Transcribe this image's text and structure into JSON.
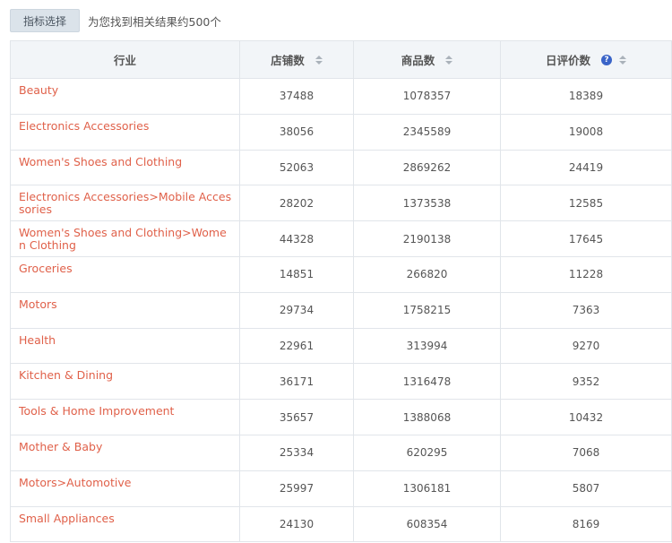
{
  "toolbar": {
    "filter_button": "指标选择",
    "result_text": "为您找到相关结果约500个"
  },
  "table": {
    "headers": {
      "industry": "行业",
      "stores": "店铺数",
      "products": "商品数",
      "daily_reviews": "日评价数"
    },
    "help_icon_glyph": "?",
    "rows": [
      {
        "industry": "Beauty",
        "stores": "37488",
        "products": "1078357",
        "daily_reviews": "18389"
      },
      {
        "industry": "Electronics Accessories",
        "stores": "38056",
        "products": "2345589",
        "daily_reviews": "19008"
      },
      {
        "industry": "Women's Shoes and Clothing",
        "stores": "52063",
        "products": "2869262",
        "daily_reviews": "24419"
      },
      {
        "industry": "Electronics Accessories>Mobile Accessories",
        "stores": "28202",
        "products": "1373538",
        "daily_reviews": "12585"
      },
      {
        "industry": "Women's Shoes and Clothing>Women Clothing",
        "stores": "44328",
        "products": "2190138",
        "daily_reviews": "17645"
      },
      {
        "industry": "Groceries",
        "stores": "14851",
        "products": "266820",
        "daily_reviews": "11228"
      },
      {
        "industry": "Motors",
        "stores": "29734",
        "products": "1758215",
        "daily_reviews": "7363"
      },
      {
        "industry": "Health",
        "stores": "22961",
        "products": "313994",
        "daily_reviews": "9270"
      },
      {
        "industry": "Kitchen & Dining",
        "stores": "36171",
        "products": "1316478",
        "daily_reviews": "9352"
      },
      {
        "industry": "Tools & Home Improvement",
        "stores": "35657",
        "products": "1388068",
        "daily_reviews": "10432"
      },
      {
        "industry": "Mother & Baby",
        "stores": "25334",
        "products": "620295",
        "daily_reviews": "7068"
      },
      {
        "industry": "Motors>Automotive",
        "stores": "25997",
        "products": "1306181",
        "daily_reviews": "5807"
      },
      {
        "industry": "Small Appliances",
        "stores": "24130",
        "products": "608354",
        "daily_reviews": "8169"
      }
    ]
  },
  "colors": {
    "link": "#e0614a",
    "header_bg": "#f2f5f8",
    "border": "#e1e5ea",
    "help_icon": "#3a64c8"
  }
}
